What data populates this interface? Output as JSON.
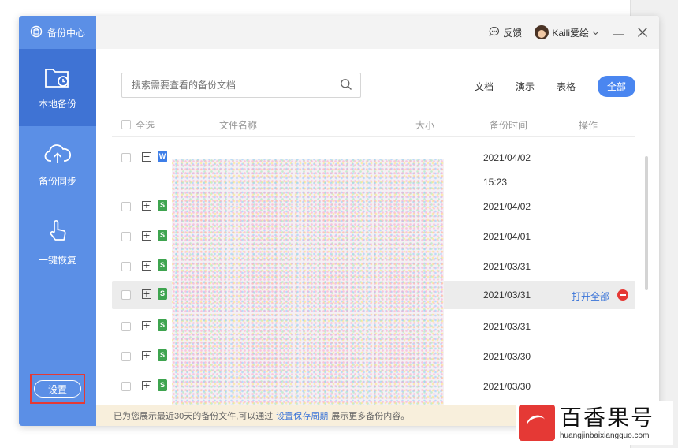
{
  "app": {
    "title": "备份中心"
  },
  "sidebar": {
    "items": [
      {
        "label": "本地备份",
        "icon": "folder-clock-icon",
        "active": true
      },
      {
        "label": "备份同步",
        "icon": "cloud-upload-icon",
        "active": false
      },
      {
        "label": "一键恢复",
        "icon": "hand-tap-icon",
        "active": false
      }
    ],
    "settings_label": "设置"
  },
  "titlebar": {
    "feedback_label": "反馈",
    "username": "Kaili爱绘"
  },
  "search": {
    "placeholder": "搜索需要查看的备份文档"
  },
  "filters": [
    {
      "label": "文档",
      "active": false
    },
    {
      "label": "演示",
      "active": false
    },
    {
      "label": "表格",
      "active": false
    },
    {
      "label": "全部",
      "active": true
    }
  ],
  "table": {
    "headers": {
      "select_all": "全选",
      "name": "文件名称",
      "size": "大小",
      "time": "备份时间",
      "ops": "操作"
    },
    "rows": [
      {
        "expander": "−",
        "type": "W",
        "date": "2021/04/02",
        "time": "15:23"
      },
      {
        "expander": "+",
        "type": "S",
        "date": "2021/04/02"
      },
      {
        "expander": "+",
        "type": "S",
        "date": "2021/04/01"
      },
      {
        "expander": "+",
        "type": "S",
        "date": "2021/03/31"
      },
      {
        "expander": "+",
        "type": "S",
        "date": "2021/03/31",
        "action": "打开全部"
      },
      {
        "expander": "+",
        "type": "S",
        "date": "2021/03/31"
      },
      {
        "expander": "+",
        "type": "S",
        "date": "2021/03/30"
      },
      {
        "expander": "+",
        "type": "S",
        "date": "2021/03/30"
      }
    ]
  },
  "footer": {
    "text_before": "已为您展示最近30天的备份文件,可以通过",
    "link": "设置保存周期",
    "text_after": "展示更多备份内容。"
  },
  "watermark": {
    "title": "百香果号",
    "url": "huangjinbaixiangguo.com"
  },
  "colors": {
    "sidebar": "#5b8fe6",
    "sidebar_active": "#3f73d4",
    "accent": "#4a86f0",
    "danger": "#e53935"
  }
}
